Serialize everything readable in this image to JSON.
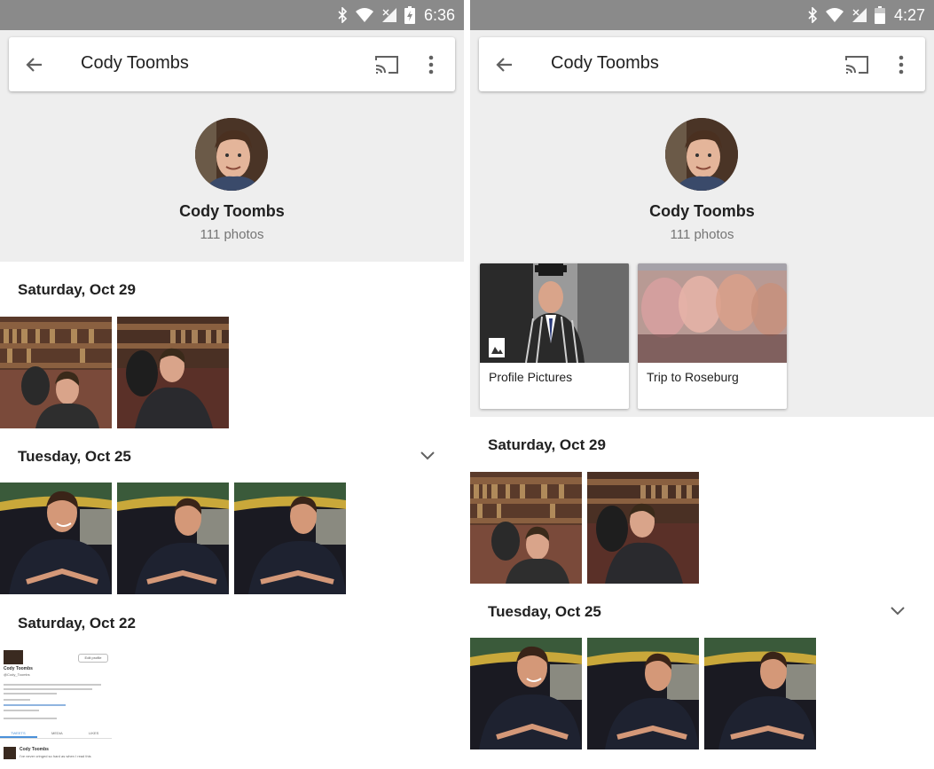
{
  "screens": [
    {
      "status": {
        "time": "6:36"
      },
      "toolbar": {
        "title": "Cody Toombs"
      },
      "profile": {
        "name": "Cody Toombs",
        "count": "111 photos"
      },
      "albums": [],
      "sections": [
        {
          "date": "Saturday, Oct 29"
        },
        {
          "date": "Tuesday, Oct 25"
        },
        {
          "date": "Saturday, Oct 22"
        }
      ],
      "tweet": {
        "name": "Cody Toombs",
        "handle": "@Cody_Toombs",
        "edit_label": "Edit profile",
        "tabs": [
          "TWEETS",
          "MEDIA",
          "LIKES"
        ],
        "tweet_text": "I've never cringed so hard as when I read this"
      }
    },
    {
      "status": {
        "time": "4:27"
      },
      "toolbar": {
        "title": "Cody Toombs"
      },
      "profile": {
        "name": "Cody Toombs",
        "count": "111 photos"
      },
      "albums": [
        {
          "label": "Profile Pictures"
        },
        {
          "label": "Trip to Roseburg"
        }
      ],
      "sections": [
        {
          "date": "Saturday, Oct 29"
        },
        {
          "date": "Tuesday, Oct 25"
        }
      ]
    }
  ],
  "colors": {
    "statusbar": "#8a8a8a",
    "header_bg": "#eeeeee",
    "card": "#ffffff"
  },
  "icons": [
    "back-arrow-icon",
    "cast-icon",
    "more-vert-icon",
    "chevron-down-icon",
    "bluetooth-icon",
    "wifi-icon",
    "signal-icon",
    "battery-icon"
  ]
}
